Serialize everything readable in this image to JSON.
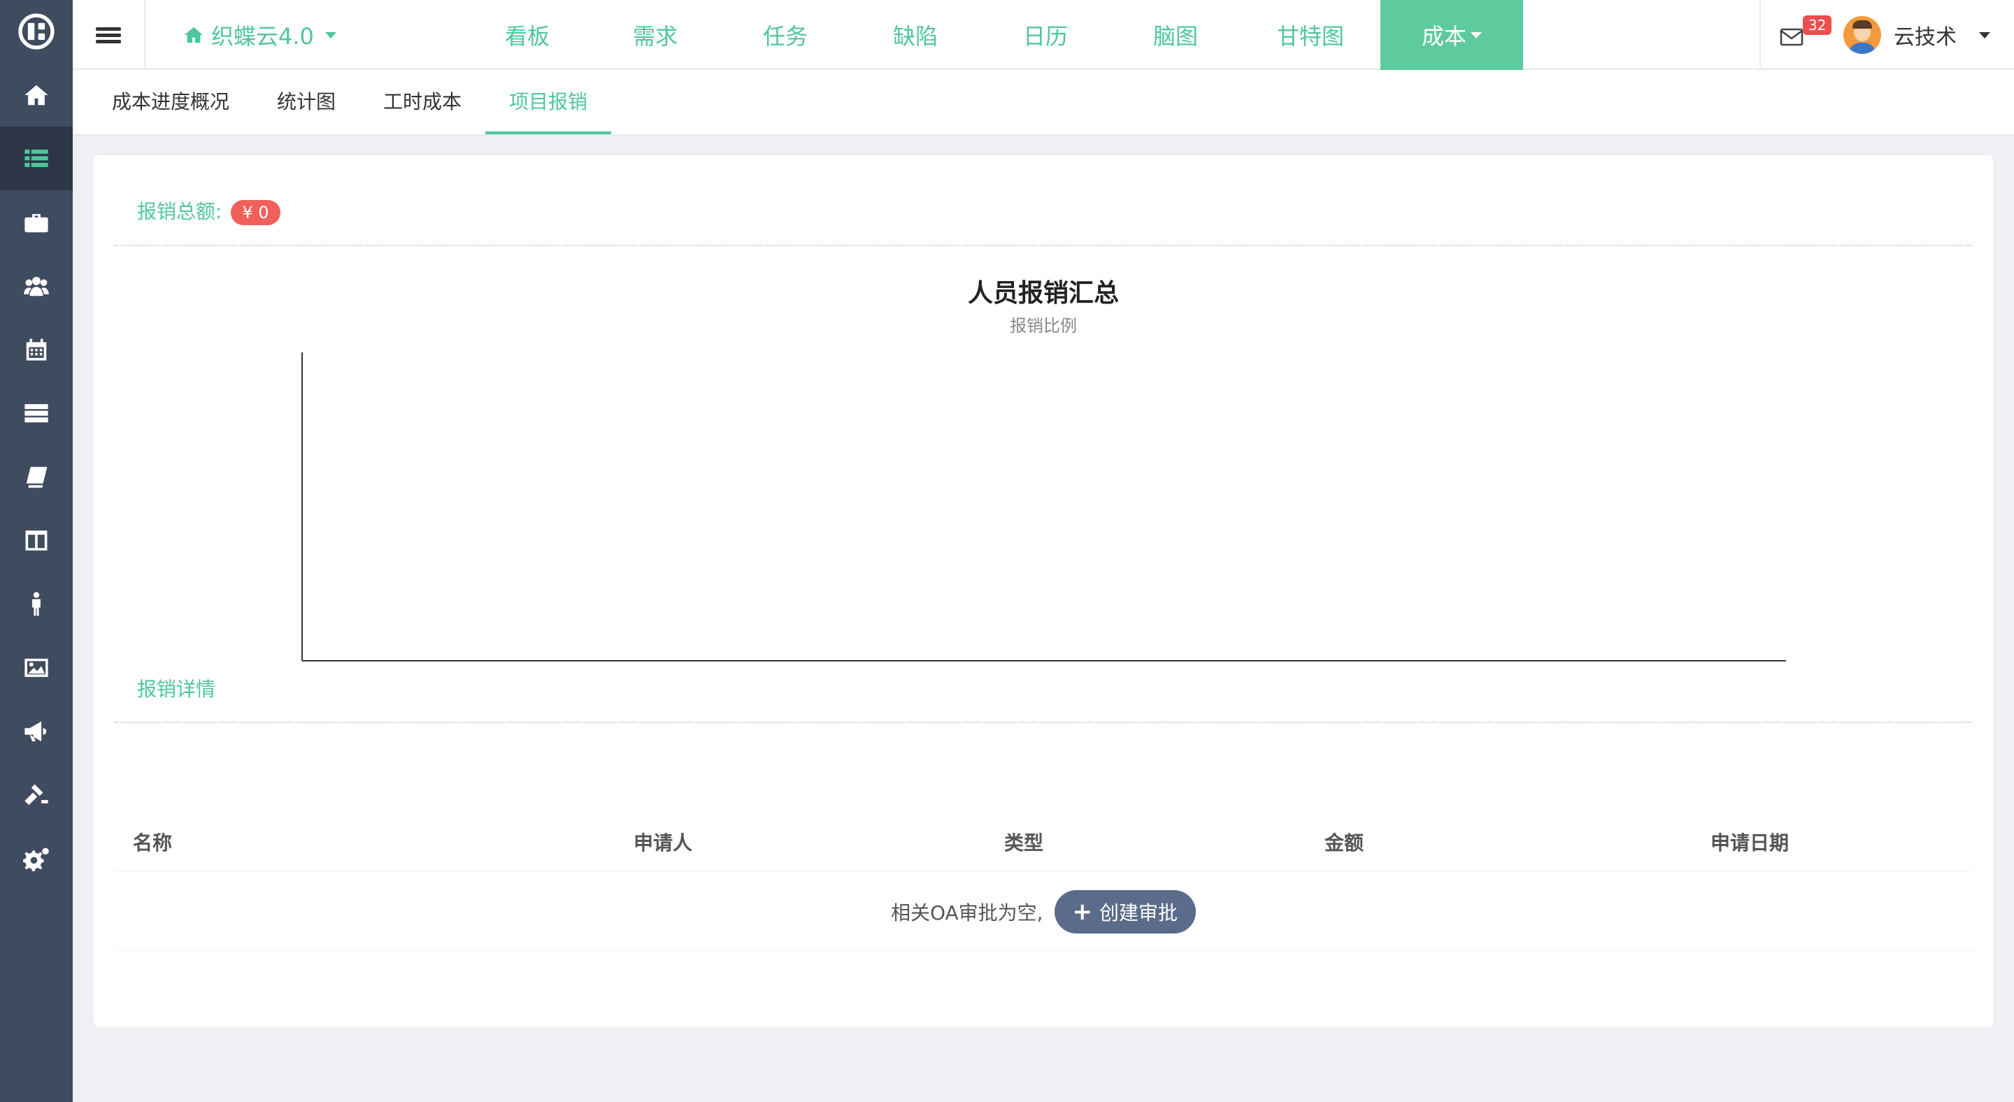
{
  "sidebar": {
    "items": [
      {
        "icon": "home-icon"
      },
      {
        "icon": "list-icon"
      },
      {
        "icon": "briefcase-icon"
      },
      {
        "icon": "users-icon"
      },
      {
        "icon": "calendar-icon"
      },
      {
        "icon": "server-icon"
      },
      {
        "icon": "book-icon"
      },
      {
        "icon": "columns-icon"
      },
      {
        "icon": "person-icon"
      },
      {
        "icon": "image-icon"
      },
      {
        "icon": "bullhorn-icon"
      },
      {
        "icon": "gavel-icon"
      },
      {
        "icon": "gears-icon"
      }
    ],
    "active_index": 1
  },
  "header": {
    "project_name": "织蝶云4.0",
    "tabs": [
      {
        "label": "看板"
      },
      {
        "label": "需求"
      },
      {
        "label": "任务"
      },
      {
        "label": "缺陷"
      },
      {
        "label": "日历"
      },
      {
        "label": "脑图"
      },
      {
        "label": "甘特图"
      },
      {
        "label": "成本"
      }
    ],
    "active_tab": "成本",
    "mail_count": "32",
    "username": "云技术"
  },
  "subtabs": [
    {
      "label": "成本进度概况"
    },
    {
      "label": "统计图"
    },
    {
      "label": "工时成本"
    },
    {
      "label": "项目报销"
    }
  ],
  "summary": {
    "total_label": "报销总额:",
    "total_value": "¥ 0"
  },
  "chart_data": {
    "type": "bar",
    "title": "人员报销汇总",
    "subtitle": "报销比例",
    "categories": [],
    "values": []
  },
  "details": {
    "section_title": "报销详情",
    "columns": [
      "名称",
      "申请人",
      "类型",
      "金额",
      "申请日期"
    ],
    "empty_text": "相关OA审批为空,",
    "create_button": "创建审批"
  },
  "colors": {
    "accent": "#4fc79a",
    "sidebar_bg": "#3f4b5e",
    "badge_red": "#f0605a",
    "button_slate": "#5b6b8a"
  }
}
